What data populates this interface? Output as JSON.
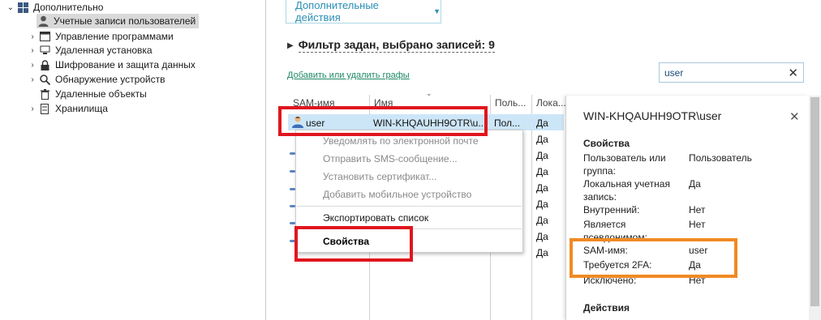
{
  "tree": {
    "root": {
      "label": "Дополнительно",
      "icon": "grid-icon"
    },
    "items": [
      {
        "label": "Учетные записи пользователей",
        "icon": "user-icon",
        "selected": true
      },
      {
        "label": "Управление программами",
        "icon": "window-icon"
      },
      {
        "label": "Удаленная установка",
        "icon": "monitor-icon"
      },
      {
        "label": "Шифрование и защита данных",
        "icon": "lock-icon"
      },
      {
        "label": "Обнаружение устройств",
        "icon": "magnifier-icon"
      },
      {
        "label": "Удаленные объекты",
        "icon": "trash-icon"
      },
      {
        "label": "Хранилища",
        "icon": "storage-icon"
      }
    ]
  },
  "toolbar": {
    "actions_label": "Дополнительные действия"
  },
  "filter": {
    "text": "Фильтр задан, выбрано записей: 9"
  },
  "add_columns_link": "Добавить или удалить графы",
  "search": {
    "value": "user"
  },
  "table": {
    "headers": [
      "SAM-имя",
      "Имя",
      "Поль...",
      "Лока..."
    ],
    "selected_row": {
      "sam": "user",
      "name": "WIN-KHQAUHH9OTR\\u...",
      "user_type": "Пол...",
      "local": "Да"
    },
    "local_column": [
      "Да",
      "Да",
      "Да",
      "Да",
      "Да",
      "Да",
      "Да",
      "Да"
    ]
  },
  "context_menu": {
    "items": [
      {
        "label": "Уведомлять по электронной почте",
        "disabled": true
      },
      {
        "label": "Отправить SMS-сообщение...",
        "disabled": true
      },
      {
        "label": "Установить сертификат...",
        "disabled": true
      },
      {
        "label": "Добавить мобильное устройство",
        "disabled": true
      },
      {
        "label": "Экспортировать список",
        "disabled": false
      },
      {
        "label": "Свойства",
        "disabled": false
      }
    ]
  },
  "panel": {
    "title": "WIN-KHQAUHH9OTR\\user",
    "section_properties": "Свойства",
    "section_actions": "Действия",
    "properties": [
      {
        "label": "Пользователь или группа:",
        "value": "Пользователь"
      },
      {
        "label": "Локальная учетная запись:",
        "value": "Да"
      },
      {
        "label": "Внутренний:",
        "value": "Нет"
      },
      {
        "label": "Является псевдонимом:",
        "value": "Нет"
      },
      {
        "label": "SAM-имя:",
        "value": "user"
      },
      {
        "label": "Требуется 2FA:",
        "value": "Да"
      },
      {
        "label": "Исключено:",
        "value": "Нет"
      }
    ]
  },
  "colors": {
    "accent": "#2b8fb6",
    "link": "#1f8a66",
    "selection": "#cde6f7",
    "highlight_red": "#e0161e",
    "highlight_orange": "#f08a24"
  }
}
